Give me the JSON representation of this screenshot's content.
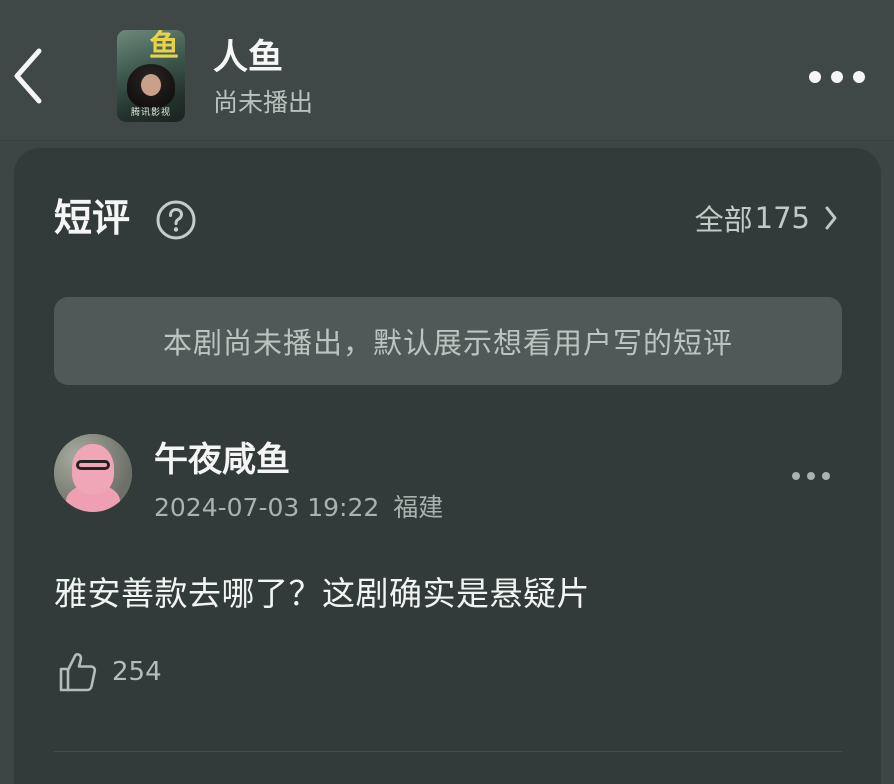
{
  "header": {
    "title": "人鱼",
    "subtitle": "尚未播出",
    "poster": {
      "glyph": "鱼",
      "caption": "腾讯影视"
    }
  },
  "reviews": {
    "section_title": "短评",
    "all_label": "全部",
    "all_count": "175",
    "notice": "本剧尚未播出，默认展示想看用户写的短评"
  },
  "comment": {
    "username": "午夜咸鱼",
    "datetime": "2024-07-03 19:22",
    "location": "福建",
    "text": "雅安善款去哪了？这剧确实是悬疑片",
    "likes": "254"
  },
  "icons": {
    "back": "back-arrow-icon",
    "more": "more-horizontal-icon",
    "help": "question-circle-icon",
    "chevron": "chevron-right-icon",
    "like": "thumbs-up-icon"
  },
  "colors": {
    "background": "#3d4644",
    "card": "#333b3a",
    "notice_bg": "#505957",
    "primary_text": "#f4f5f4",
    "secondary_text": "#aab1ae"
  }
}
